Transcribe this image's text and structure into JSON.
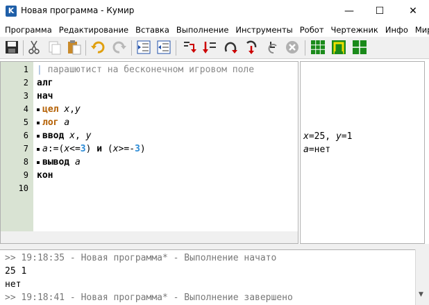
{
  "window": {
    "app_icon_letter": "K",
    "title": "Новая программа - Кумир",
    "min_glyph": "—",
    "max_glyph": "☐",
    "close_glyph": "✕"
  },
  "menu": [
    "Программа",
    "Редактирование",
    "Вставка",
    "Выполнение",
    "Инструменты",
    "Робот",
    "Чертежник",
    "Инфо",
    "Миры"
  ],
  "toolbar": {
    "buttons": [
      "save-icon",
      "cut-icon",
      "copy-icon",
      "paste-icon",
      "undo-icon",
      "redo-icon",
      "indent-icon",
      "unindent-icon",
      "run-icon",
      "run-step-icon",
      "step-over-icon",
      "step-into-icon",
      "step-out-icon",
      "stop-icon",
      "grid-world-icon",
      "robot-world-icon",
      "draw-world-icon"
    ]
  },
  "editor": {
    "lines": [
      {
        "n": "1",
        "bullet": false,
        "segments": [
          {
            "t": "| ",
            "c": "cbar"
          },
          {
            "t": "парашютист на бесконечном игровом поле",
            "c": "comment"
          }
        ]
      },
      {
        "n": "2",
        "bullet": false,
        "segments": [
          {
            "t": "алг",
            "c": "kw"
          }
        ]
      },
      {
        "n": "3",
        "bullet": false,
        "segments": [
          {
            "t": "нач",
            "c": "kw"
          }
        ]
      },
      {
        "n": "4",
        "bullet": true,
        "segments": [
          {
            "t": "цел",
            "c": "kt"
          },
          {
            "t": " ",
            "c": ""
          },
          {
            "t": "x",
            "c": "var"
          },
          {
            "t": ",",
            "c": ""
          },
          {
            "t": "y",
            "c": "var"
          }
        ]
      },
      {
        "n": "5",
        "bullet": true,
        "segments": [
          {
            "t": "лог",
            "c": "kt"
          },
          {
            "t": " ",
            "c": ""
          },
          {
            "t": "a",
            "c": "var"
          }
        ]
      },
      {
        "n": "6",
        "bullet": true,
        "segments": [
          {
            "t": "ввод",
            "c": "kw"
          },
          {
            "t": " ",
            "c": ""
          },
          {
            "t": "x",
            "c": "var"
          },
          {
            "t": ", ",
            "c": ""
          },
          {
            "t": "y",
            "c": "var"
          }
        ]
      },
      {
        "n": "7",
        "bullet": true,
        "segments": [
          {
            "t": "a",
            "c": "var"
          },
          {
            "t": ":=(",
            "c": ""
          },
          {
            "t": "x",
            "c": "var"
          },
          {
            "t": "<=",
            "c": ""
          },
          {
            "t": "3",
            "c": "num"
          },
          {
            "t": ") ",
            "c": ""
          },
          {
            "t": "и",
            "c": "kw"
          },
          {
            "t": " (",
            "c": ""
          },
          {
            "t": "x",
            "c": "var"
          },
          {
            "t": ">=-",
            "c": ""
          },
          {
            "t": "3",
            "c": "num"
          },
          {
            "t": ")",
            "c": ""
          }
        ]
      },
      {
        "n": "8",
        "bullet": true,
        "segments": [
          {
            "t": "вывод",
            "c": "kw"
          },
          {
            "t": " ",
            "c": ""
          },
          {
            "t": "a",
            "c": "var"
          }
        ]
      },
      {
        "n": "9",
        "bullet": false,
        "segments": [
          {
            "t": "кон",
            "c": "kw"
          }
        ]
      },
      {
        "n": "10",
        "bullet": false,
        "segments": []
      }
    ]
  },
  "margin": {
    "lines": [
      {
        "line_index": 6,
        "segments": [
          {
            "t": "x",
            "c": "var"
          },
          {
            "t": "=25, ",
            "c": ""
          },
          {
            "t": "y",
            "c": "var"
          },
          {
            "t": "=1",
            "c": ""
          }
        ]
      },
      {
        "line_index": 7,
        "segments": [
          {
            "t": "a",
            "c": "var"
          },
          {
            "t": "=нет",
            "c": ""
          }
        ]
      }
    ]
  },
  "console": {
    "lines": [
      {
        "text": ">> 19:18:35 - Новая программа* - Выполнение начато",
        "type": "sys"
      },
      {
        "text": "25 1",
        "type": "out"
      },
      {
        "text": "нет",
        "type": "out"
      },
      {
        "text": ">> 19:18:41 - Новая программа* - Выполнение завершено",
        "type": "sys"
      }
    ],
    "scroll_down_glyph": "▼"
  }
}
